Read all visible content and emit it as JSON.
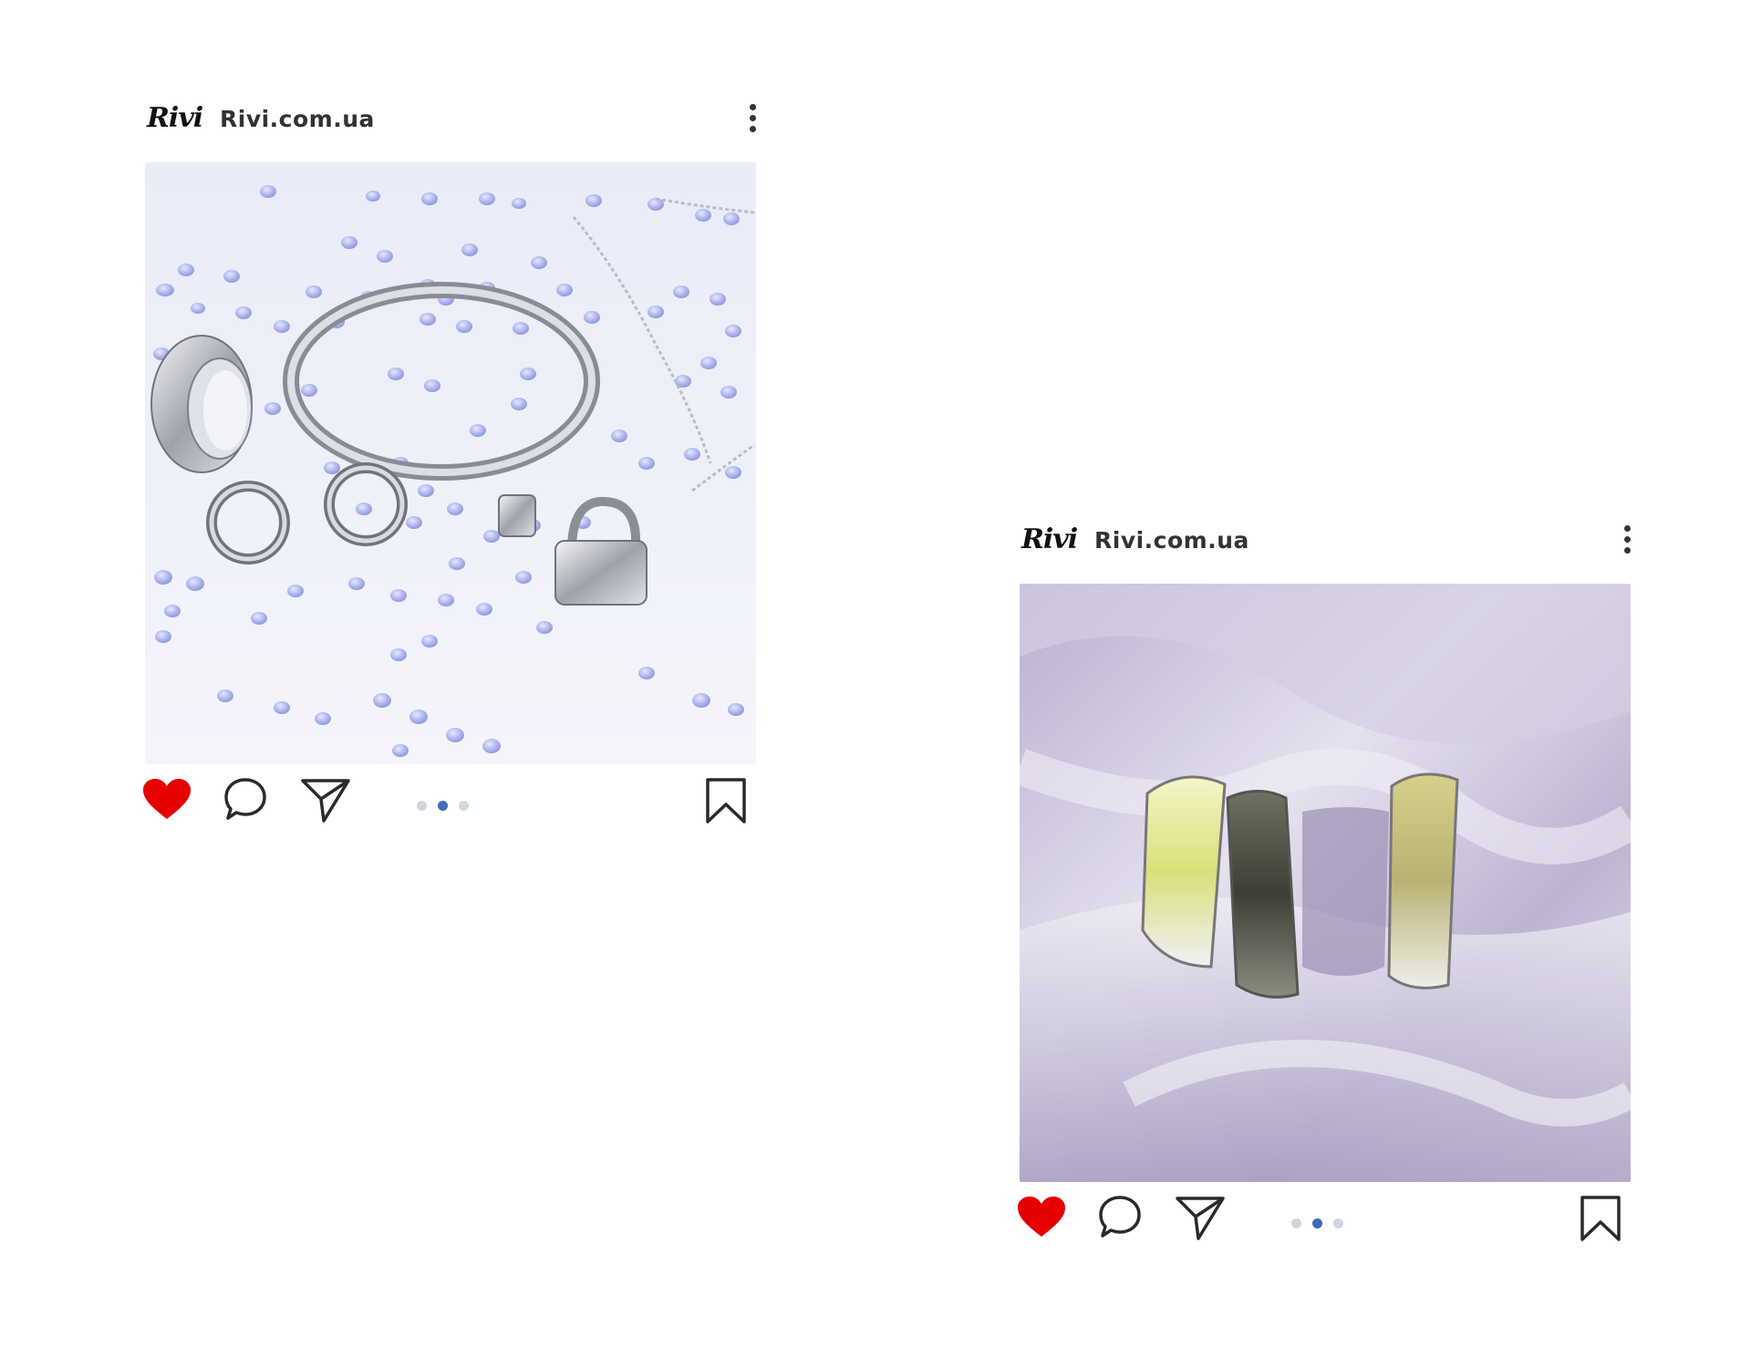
{
  "posts": [
    {
      "logo": "Rivi",
      "account": "Rivi.com.ua",
      "carousel": {
        "count": 3,
        "active_index": 1
      },
      "liked": true
    },
    {
      "logo": "Rivi",
      "account": "Rivi.com.ua",
      "carousel": {
        "count": 3,
        "active_index": 1
      },
      "liked": true
    }
  ],
  "colors": {
    "like_red": "#e60000",
    "dot_active": "#3b6dbb",
    "dot_inactive": "#cfd6de",
    "icon_stroke": "#2a2a2a"
  },
  "icons": [
    "more-vertical-icon",
    "heart-icon",
    "comment-icon",
    "send-icon",
    "bookmark-icon"
  ]
}
